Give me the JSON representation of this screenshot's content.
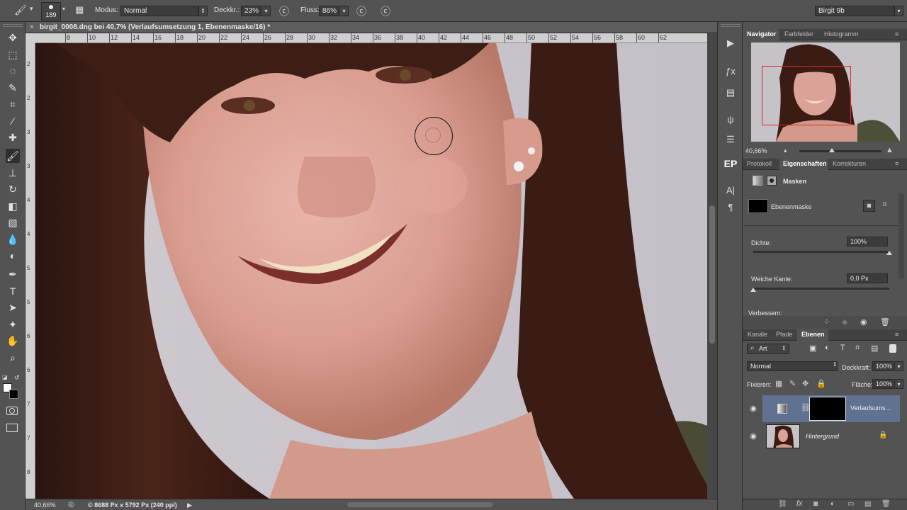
{
  "options_bar": {
    "brush_size": "189",
    "mode_label": "Modus:",
    "mode_value": "Normal",
    "opacity_label": "Deckkr.:",
    "opacity_value": "23%",
    "flow_label": "Fluss:",
    "flow_value": "86%",
    "workspace_value": "Birgit 9b"
  },
  "document": {
    "tab_title": "birgit_0008.dng bei 40,7% (Verlaufsumsetzung 1, Ebenenmaske/16) *",
    "ruler_h": [
      "8",
      "10",
      "12",
      "14",
      "16",
      "18",
      "20",
      "22",
      "24",
      "26",
      "28",
      "30",
      "32",
      "34",
      "36",
      "38",
      "40",
      "42",
      "44",
      "46",
      "48",
      "50",
      "52",
      "54",
      "56",
      "58",
      "60",
      "62"
    ],
    "ruler_v": [
      "2",
      "2",
      "3",
      "3",
      "4",
      "4",
      "5",
      "5",
      "6",
      "6",
      "7",
      "7",
      "8"
    ],
    "zoom": "40,66%",
    "doc_info": "© 8688 Px x 5792 Px (240 ppi)"
  },
  "navigator": {
    "tabs": [
      "Navigator",
      "Farbfelder",
      "Histogramm"
    ],
    "zoom": "40,66%"
  },
  "properties": {
    "tabs": [
      "Protokoll",
      "Eigenschaften",
      "Korrekturen"
    ],
    "masks_label": "Masken",
    "layer_mask_label": "Ebenenmaske",
    "density_label": "Dichte:",
    "density_value": "100%",
    "density_level": 1.0,
    "feather_label": "Weiche Kante:",
    "feather_value": "0,0 Px",
    "feather_level": 0.0,
    "refine_label": "Verbessern:"
  },
  "layers": {
    "tabs": [
      "Kanäle",
      "Pfade",
      "Ebenen"
    ],
    "filter_label": "Art",
    "blend_mode": "Normal",
    "opacity_label": "Deckkraft:",
    "opacity_value": "100%",
    "lock_label": "Fixieren:",
    "fill_label": "Fläche:",
    "fill_value": "100%",
    "items": [
      {
        "name": "Verlaufsums...",
        "type": "adjustment"
      },
      {
        "name": "Hintergrund",
        "type": "background"
      }
    ]
  },
  "colors": {
    "panel_bg": "#535353",
    "selected_layer": "#5f7290",
    "navigator_frame": "#e0242e"
  },
  "icons": {
    "tools": [
      "move-icon",
      "marquee-icon",
      "lasso-icon",
      "quick-select-icon",
      "crop-icon",
      "eyedropper-icon",
      "healing-icon",
      "brush-icon",
      "stamp-icon",
      "history-brush-icon",
      "eraser-icon",
      "gradient-icon",
      "blur-icon",
      "dodge-icon",
      "pen-icon",
      "type-icon",
      "path-select-icon",
      "shape-icon",
      "hand-icon",
      "zoom-icon"
    ],
    "tool_glyphs": [
      "✥",
      "⬚",
      "◌",
      "✎",
      "⌗",
      "⁄",
      "✚",
      "🖌",
      "⊥",
      "↻",
      "◧",
      "▧",
      "💧",
      "◐",
      "✒",
      "T",
      "➤",
      "✦",
      "✋",
      "⌕"
    ],
    "strip": [
      "play-icon",
      "fx-icon",
      "layers-stack-icon",
      "brush-preset-icon",
      "sliders-icon",
      "ep-icon",
      "character-icon",
      "paragraph-icon"
    ],
    "strip_glyphs": [
      "▶",
      "ƒx",
      "▤",
      "ψ",
      "☰",
      "EP",
      "A|",
      "¶"
    ]
  }
}
